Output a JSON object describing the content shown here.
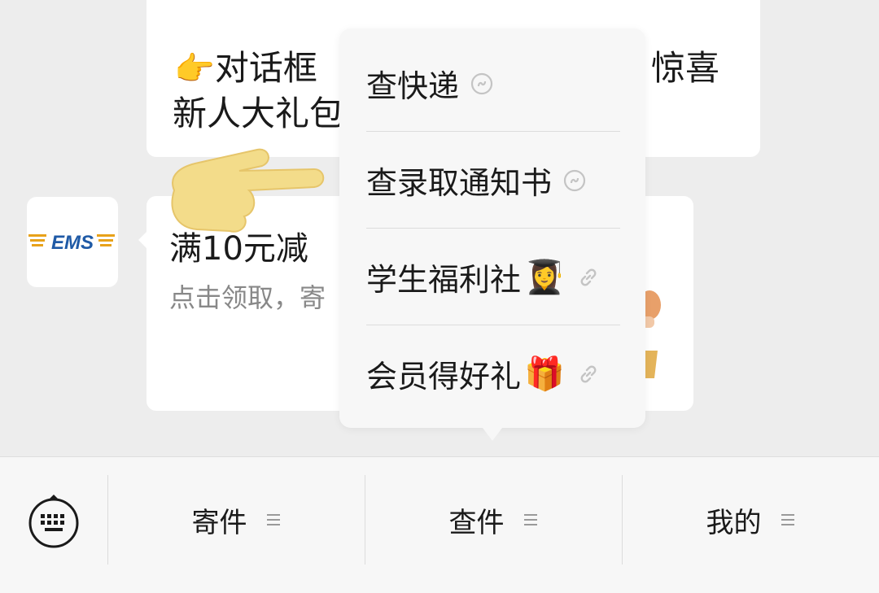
{
  "message_top": {
    "line1_emoji": "👉",
    "line1_text": "对话框",
    "line1_right": "惊喜",
    "line2_text": "新人大礼包"
  },
  "brand": {
    "name": "EMS",
    "colors": {
      "blue": "#1f5aa6",
      "gold": "#e8a21a"
    }
  },
  "message_mid": {
    "title": "满10元减",
    "subtitle": "点击领取，寄"
  },
  "popup_menu": {
    "items": [
      {
        "label": "查快递",
        "emoji": "",
        "icon": "mini-program-icon"
      },
      {
        "label": "查录取通知书",
        "emoji": "",
        "icon": "mini-program-icon"
      },
      {
        "label": "学生福利社",
        "emoji": "👩‍🎓",
        "icon": "link-icon"
      },
      {
        "label": "会员得好礼",
        "emoji": "🎁",
        "icon": "link-icon"
      }
    ]
  },
  "bottom_menu": {
    "keyboard_icon": "keyboard-icon",
    "tabs": [
      {
        "label": "寄件",
        "icon": "menu-lines-icon"
      },
      {
        "label": "查件",
        "icon": "menu-lines-icon"
      },
      {
        "label": "我的",
        "icon": "menu-lines-icon"
      }
    ]
  }
}
